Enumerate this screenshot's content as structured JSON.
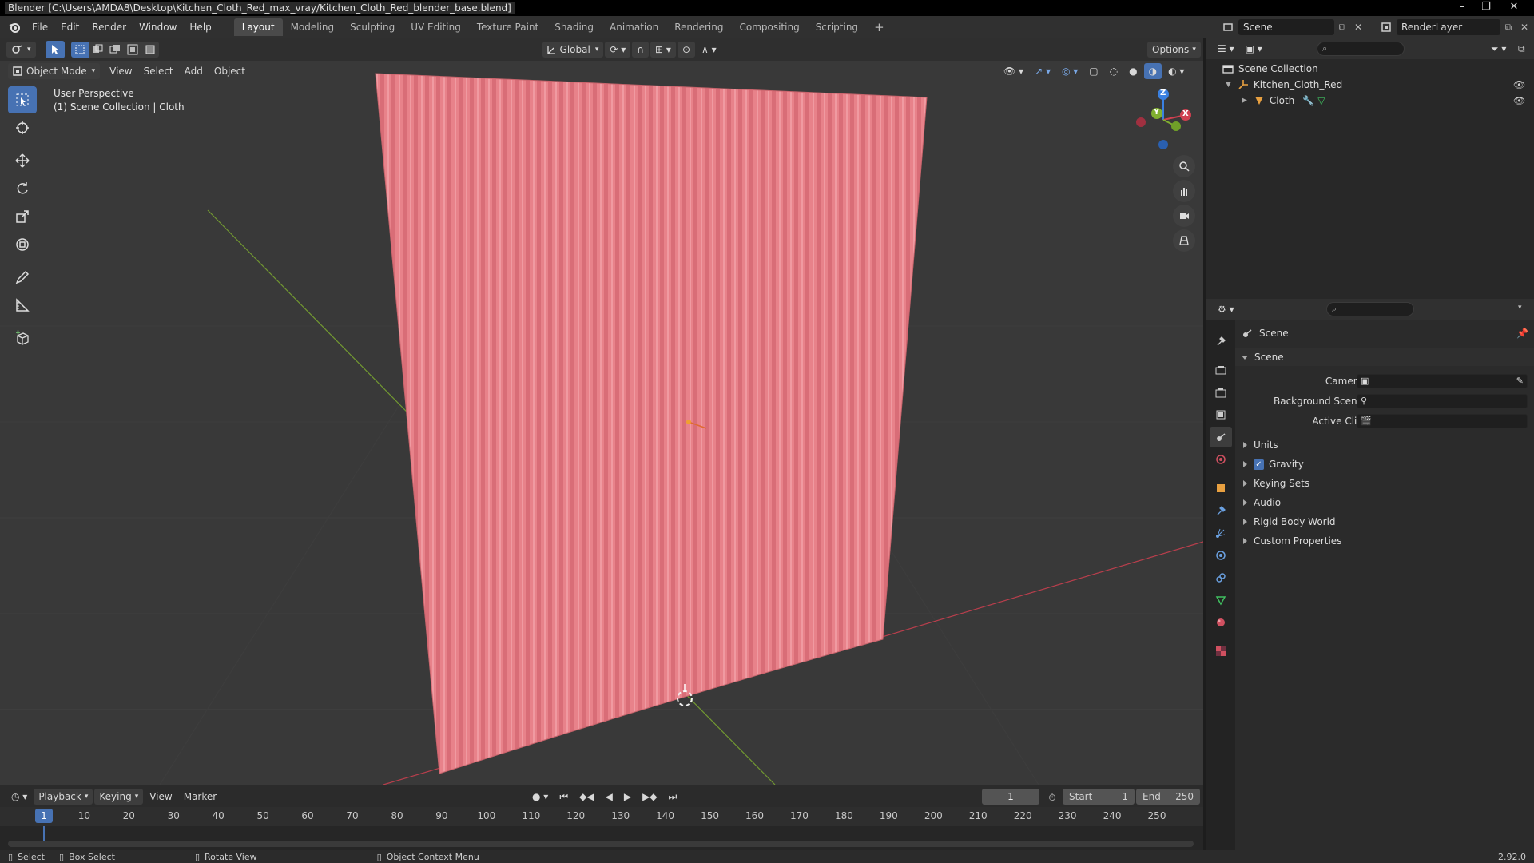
{
  "window": {
    "title": "Blender [C:\\Users\\AMDA8\\Desktop\\Kitchen_Cloth_Red_max_vray/Kitchen_Cloth_Red_blender_base.blend]",
    "minimize": "–",
    "restore": "❐",
    "close": "✕"
  },
  "menu": [
    "File",
    "Edit",
    "Render",
    "Window",
    "Help"
  ],
  "workspaces": [
    "Layout",
    "Modeling",
    "Sculpting",
    "UV Editing",
    "Texture Paint",
    "Shading",
    "Animation",
    "Rendering",
    "Compositing",
    "Scripting"
  ],
  "active_workspace": "Layout",
  "scene_name": "Scene",
  "render_layer": "RenderLayer",
  "viewport": {
    "transform_orientation": "Global",
    "options_label": "Options",
    "mode": "Object Mode",
    "menus": [
      "View",
      "Select",
      "Add",
      "Object"
    ],
    "overlay_line1": "User Perspective",
    "overlay_line2": "(1) Scene Collection | Cloth",
    "gizmo_axes": {
      "x": "X",
      "y": "Y",
      "z": "Z"
    }
  },
  "outliner": {
    "root": "Scene Collection",
    "collection": "Kitchen_Cloth_Red",
    "object": "Cloth"
  },
  "properties": {
    "context": "Scene",
    "panel_title": "Scene",
    "camera_label": "Camera",
    "background_scene_label": "Background Scene",
    "active_clip_label": "Active Clip",
    "panels": [
      "Units",
      "Gravity",
      "Keying Sets",
      "Audio",
      "Rigid Body World",
      "Custom Properties"
    ],
    "gravity_checked": true
  },
  "timeline": {
    "menus": [
      "Playback",
      "Keying",
      "View",
      "Marker"
    ],
    "current_frame": "1",
    "start_label": "Start",
    "start": "1",
    "end_label": "End",
    "end": "250",
    "ticks": [
      "1",
      "10",
      "20",
      "30",
      "40",
      "50",
      "60",
      "70",
      "80",
      "90",
      "100",
      "110",
      "120",
      "130",
      "140",
      "150",
      "160",
      "170",
      "180",
      "190",
      "200",
      "210",
      "220",
      "230",
      "240",
      "250"
    ]
  },
  "statusbar": {
    "select": "Select",
    "box_select": "Box Select",
    "rotate_view": "Rotate View",
    "context_menu": "Object Context Menu",
    "version": "2.92.0"
  },
  "colors": {
    "accent": "#4772b3",
    "cloth": "#e8828a",
    "x_axis": "#d04050",
    "y_axis": "#80b030",
    "z_axis": "#3a80e0"
  }
}
